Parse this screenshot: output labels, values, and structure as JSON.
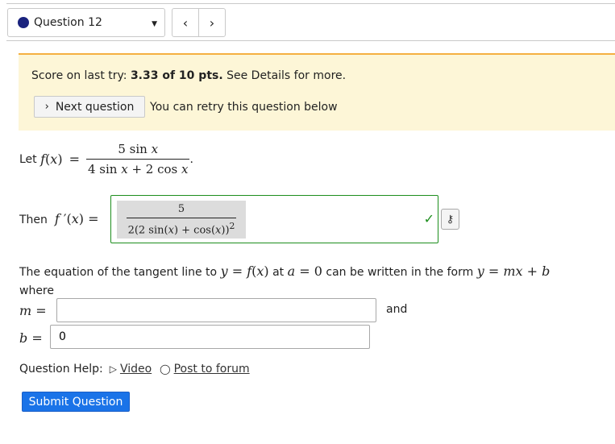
{
  "nav": {
    "question_label": "Question 12",
    "prev_label": "‹",
    "next_label": "›"
  },
  "score_panel": {
    "prefix": "Score on last try: ",
    "score": "3.33 of 10 pts.",
    "suffix": " See Details for more.",
    "next_button": "Next question",
    "retry_text": "You can retry this question below"
  },
  "problem": {
    "let_text": "Let",
    "then_text": "Then",
    "answer_check": "✓"
  },
  "tangent": {
    "text_1": "The equation of the tangent line to",
    "text_2": "at",
    "text_3": "can be written in the form",
    "text_4": "where",
    "and_text": "and"
  },
  "inputs": {
    "m_value": "",
    "b_value": "0"
  },
  "help": {
    "label": "Question Help:",
    "video": "Video",
    "forum": "Post to forum"
  },
  "submit_label": "Submit Question",
  "colors": {
    "accent": "#1a73e8",
    "correct": "#1d8e1d",
    "panel_bg": "#fdf6d7",
    "panel_border": "#f5b041"
  }
}
